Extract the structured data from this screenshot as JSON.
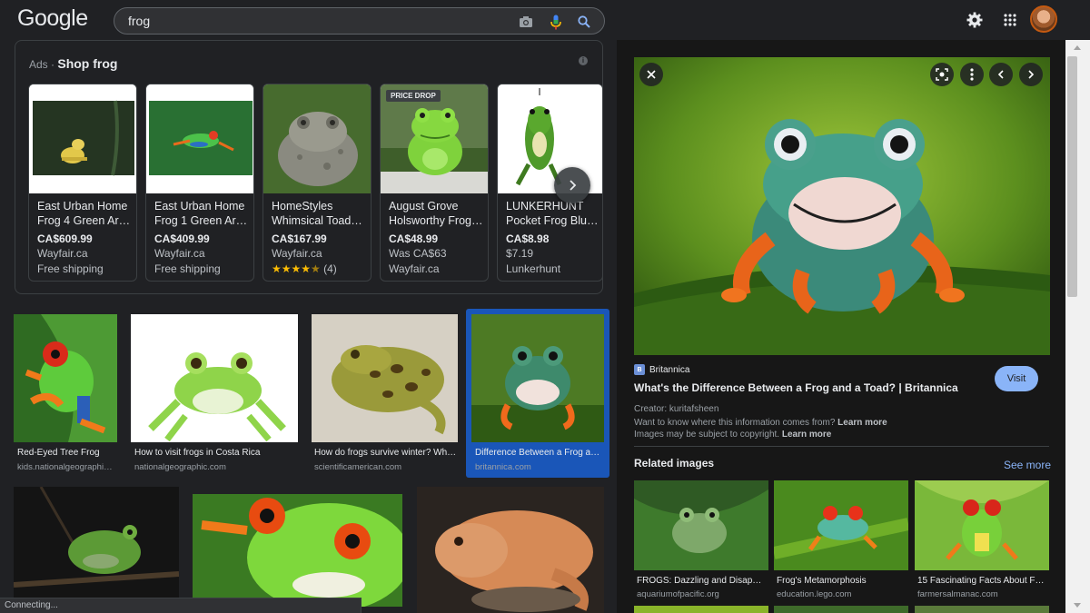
{
  "header": {
    "logo": "Google",
    "search_value": "frog",
    "icons": [
      "camera-icon",
      "mic-icon",
      "search-icon",
      "settings-icon",
      "apps-icon"
    ]
  },
  "ads": {
    "label": "Ads",
    "title": "Shop frog",
    "products": [
      {
        "name1": "East Urban Home",
        "name2": "Frog 4 Green Area…",
        "price": "CA$609.99",
        "line1": "Wayfair.ca",
        "line2": "Free shipping"
      },
      {
        "name1": "East Urban Home",
        "name2": "Frog 1 Green Area…",
        "price": "CA$409.99",
        "line1": "Wayfair.ca",
        "line2": "Free shipping"
      },
      {
        "name1": "HomeStyles",
        "name2": "Whimsical Toad…",
        "price": "CA$167.99",
        "line1": "Wayfair.ca",
        "line2": "★★★★★ (4)",
        "rating": 4.5
      },
      {
        "name1": "August Grove",
        "name2": "Holsworthy Frog…",
        "price": "CA$48.99",
        "line1": "Was CA$63",
        "line2": "Wayfair.ca",
        "badge": "PRICE DROP"
      },
      {
        "name1": "LUNKERHUNT",
        "name2": "Pocket Frog Blue…",
        "price": "CA$8.98",
        "line1": "$7.19",
        "line2": "Lunkerhunt"
      }
    ]
  },
  "results": [
    {
      "caption": "Red-Eyed Tree Frog",
      "source": "kids.nationalgeographic…"
    },
    {
      "caption": "How to visit frogs in Costa Rica",
      "source": "nationalgeographic.com"
    },
    {
      "caption": "How do frogs survive winter? Why …",
      "source": "scientificamerican.com"
    },
    {
      "caption": "Difference Between a Frog an…",
      "source": "britannica.com"
    }
  ],
  "status": "Connecting...",
  "panel": {
    "site": "Britannica",
    "visit": "Visit",
    "title": "What's the Difference Between a Frog and a Toad? | Britannica",
    "creator": "Creator: kuritafsheen",
    "want_text": "Want to know where this information comes from?",
    "learn_more": "Learn more",
    "copyright_text": "Images may be subject to copyright.",
    "related_title": "Related images",
    "see_more": "See more",
    "related": [
      {
        "caption": "FROGS: Dazzling and Disappea…",
        "source": "aquariumofpacific.org"
      },
      {
        "caption": "Frog's Metamorphosis",
        "source": "education.lego.com"
      },
      {
        "caption": "15 Fascinating Facts About Fro…",
        "source": "farmersalmanac.com"
      }
    ]
  }
}
